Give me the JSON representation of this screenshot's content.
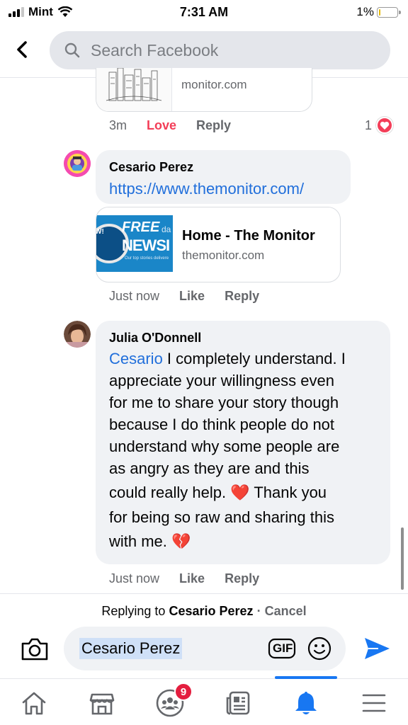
{
  "status_bar": {
    "carrier": "Mint",
    "time": "7:31 AM",
    "battery_percent": "1%",
    "battery_level": 0.01
  },
  "header": {
    "back_icon": "chevron-left-icon",
    "search_placeholder": "Search Facebook"
  },
  "thread": {
    "previous_comment": {
      "link_domain": "monitor.com",
      "time": "3m",
      "reaction_label": "Love",
      "reply_label": "Reply",
      "reaction_count": "1",
      "reaction_icon": "heart-icon"
    },
    "comments": [
      {
        "author": "Cesario Perez",
        "text": "https://www.themonitor.com/",
        "preview": {
          "thumb_line1": "FREE",
          "thumb_line1b": "da",
          "thumb_line2": "NEWSI",
          "thumb_caption": "Our top stories delivere",
          "thumb_left": "W!",
          "title": "Home - The Monitor",
          "domain": "themonitor.com"
        },
        "time": "Just now",
        "like_label": "Like",
        "reply_label": "Reply"
      },
      {
        "author": "Julia O'Donnell",
        "mention": "Cesario",
        "lines": [
          " I completely understand. I",
          "appreciate your willingness even",
          "for me to share your story though",
          "because I do think people do not",
          "understand why some people are",
          "as angry as they are and this",
          "could really help. ❤️ Thank you",
          "for being so raw and sharing this",
          "with me. 💔"
        ],
        "time": "Just now",
        "like_label": "Like",
        "reply_label": "Reply"
      }
    ]
  },
  "composer": {
    "replying_prefix": "Replying to",
    "replying_to": "Cesario Perez",
    "separator": "·",
    "cancel_label": "Cancel",
    "input_value": "Cesario Perez",
    "gif_label": "GIF",
    "camera_icon": "camera-icon",
    "emoji_icon": "emoji-icon",
    "send_icon": "send-icon"
  },
  "bottom_nav": {
    "items": [
      {
        "icon": "home-icon"
      },
      {
        "icon": "marketplace-icon"
      },
      {
        "icon": "groups-icon",
        "badge": "9"
      },
      {
        "icon": "news-icon"
      },
      {
        "icon": "notifications-bell-icon",
        "active": true
      },
      {
        "icon": "menu-icon"
      }
    ],
    "accent": "#1877f2"
  }
}
